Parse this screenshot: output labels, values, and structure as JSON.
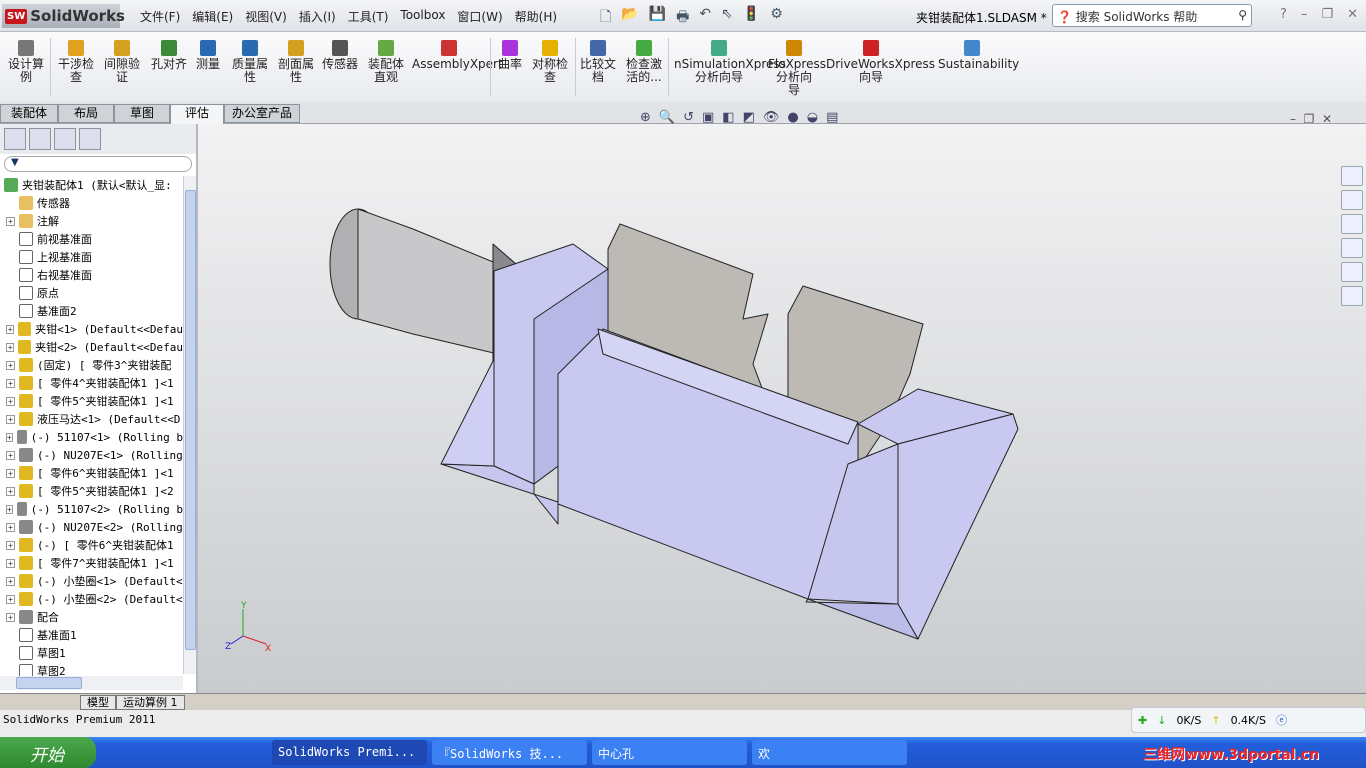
{
  "app": {
    "name": "SolidWorks",
    "doc_title": "夹钳装配体1.SLDASM *",
    "search_placeholder": "搜索 SolidWorks 帮助"
  },
  "menu": [
    "文件(F)",
    "编辑(E)",
    "视图(V)",
    "插入(I)",
    "工具(T)",
    "Toolbox",
    "窗口(W)",
    "帮助(H)"
  ],
  "ribbon": [
    {
      "label": "设计算\n例",
      "icon": "design-study-icon",
      "color": "#777"
    },
    {
      "label": "干涉检\n查",
      "icon": "interference-icon",
      "color": "#e0a020"
    },
    {
      "label": "间隙验\n证",
      "icon": "clearance-icon",
      "color": "#d4a020"
    },
    {
      "label": "孔对齐",
      "icon": "hole-align-icon",
      "color": "#3a8a3a"
    },
    {
      "label": "测量",
      "icon": "measure-icon",
      "color": "#2a6ab0"
    },
    {
      "label": "质量属\n性",
      "icon": "mass-props-icon",
      "color": "#2a6ab0"
    },
    {
      "label": "剖面属\n性",
      "icon": "section-props-icon",
      "color": "#d4a020"
    },
    {
      "label": "传感器",
      "icon": "sensor-icon",
      "color": "#555"
    },
    {
      "label": "装配体\n直观",
      "icon": "assembly-visual-icon",
      "color": "#6a4"
    },
    {
      "label": "AssemblyXpert",
      "icon": "assemblyxpert-icon",
      "color": "#c33"
    },
    {
      "label": "曲率",
      "icon": "curvature-icon",
      "color": "#a3d"
    },
    {
      "label": "对称检\n查",
      "icon": "symmetry-icon",
      "color": "#e8b000"
    },
    {
      "label": "比较文\n档",
      "icon": "compare-icon",
      "color": "#46a"
    },
    {
      "label": "检查激\n活的...",
      "icon": "check-active-icon",
      "color": "#4a4"
    },
    {
      "label": "nSimulationXpress\n分析向导",
      "icon": "simulationxpress-icon",
      "color": "#4a8"
    },
    {
      "label": "FloXpress\n分析向\n导",
      "icon": "floxpress-icon",
      "color": "#c80"
    },
    {
      "label": "DriveWorksXpress\n向导",
      "icon": "driveworks-icon",
      "color": "#c22"
    },
    {
      "label": "Sustainability",
      "icon": "sustainability-icon",
      "color": "#48c"
    }
  ],
  "tabs": [
    "装配体",
    "布局",
    "草图",
    "评估",
    "办公室产品"
  ],
  "active_tab": "评估",
  "tree": [
    {
      "label": "夹钳装配体1  (默认<默认_显:",
      "expand": false,
      "icon": "assembly-icon",
      "root": true
    },
    {
      "label": "传感器",
      "expand": false,
      "icon": "sensor-folder-icon"
    },
    {
      "label": "注解",
      "expand": true,
      "icon": "annotation-icon"
    },
    {
      "label": "前视基准面",
      "expand": false,
      "icon": "plane-icon"
    },
    {
      "label": "上视基准面",
      "expand": false,
      "icon": "plane-icon"
    },
    {
      "label": "右视基准面",
      "expand": false,
      "icon": "plane-icon"
    },
    {
      "label": "原点",
      "expand": false,
      "icon": "origin-icon"
    },
    {
      "label": "基准面2",
      "expand": false,
      "icon": "plane-icon"
    },
    {
      "label": "夹钳<1> (Default<<Defau",
      "expand": true,
      "icon": "part-icon"
    },
    {
      "label": "夹钳<2> (Default<<Defau",
      "expand": true,
      "icon": "part-icon"
    },
    {
      "label": "(固定) [ 零件3^夹钳装配",
      "expand": true,
      "icon": "part-icon"
    },
    {
      "label": "[ 零件4^夹钳装配体1 ]<1",
      "expand": true,
      "icon": "part-icon"
    },
    {
      "label": "[ 零件5^夹钳装配体1 ]<1",
      "expand": true,
      "icon": "part-icon"
    },
    {
      "label": "液压马达<1> (Default<<D",
      "expand": true,
      "icon": "part-icon"
    },
    {
      "label": "(-) 51107<1> (Rolling b",
      "expand": true,
      "icon": "toolbox-part-icon"
    },
    {
      "label": "(-) NU207E<1> (Rolling ",
      "expand": true,
      "icon": "toolbox-part-icon"
    },
    {
      "label": "[ 零件6^夹钳装配体1 ]<1",
      "expand": true,
      "icon": "part-icon"
    },
    {
      "label": "[ 零件5^夹钳装配体1 ]<2",
      "expand": true,
      "icon": "part-icon"
    },
    {
      "label": "(-) 51107<2> (Rolling b",
      "expand": true,
      "icon": "toolbox-part-icon"
    },
    {
      "label": "(-) NU207E<2> (Rolling ",
      "expand": true,
      "icon": "toolbox-part-icon"
    },
    {
      "label": "(-) [ 零件6^夹钳装配体1",
      "expand": true,
      "icon": "part-icon"
    },
    {
      "label": "[ 零件7^夹钳装配体1 ]<1",
      "expand": true,
      "icon": "part-icon"
    },
    {
      "label": "(-) 小垫圈<1> (Default<",
      "expand": true,
      "icon": "part-icon"
    },
    {
      "label": "(-) 小垫圈<2> (Default<",
      "expand": true,
      "icon": "part-icon"
    },
    {
      "label": "配合",
      "expand": true,
      "icon": "mates-icon"
    },
    {
      "label": "基准面1",
      "expand": false,
      "icon": "plane-icon"
    },
    {
      "label": "草图1",
      "expand": false,
      "icon": "sketch-icon"
    },
    {
      "label": "草图2",
      "expand": false,
      "icon": "sketch-icon"
    }
  ],
  "bottom_tabs": [
    "模型",
    "运动算例 1"
  ],
  "status": "SolidWorks Premium 2011",
  "net": {
    "down": "0K/S",
    "up": "0.4K/S"
  },
  "taskbar": {
    "start": "开始",
    "tasks": [
      "SolidWorks Premi...",
      "『SolidWorks 技...",
      "中心孔",
      "欢"
    ],
    "watermark": "三维网www.3dportal.cn"
  },
  "triad": {
    "x": "X",
    "y": "Y",
    "z": "Z"
  }
}
